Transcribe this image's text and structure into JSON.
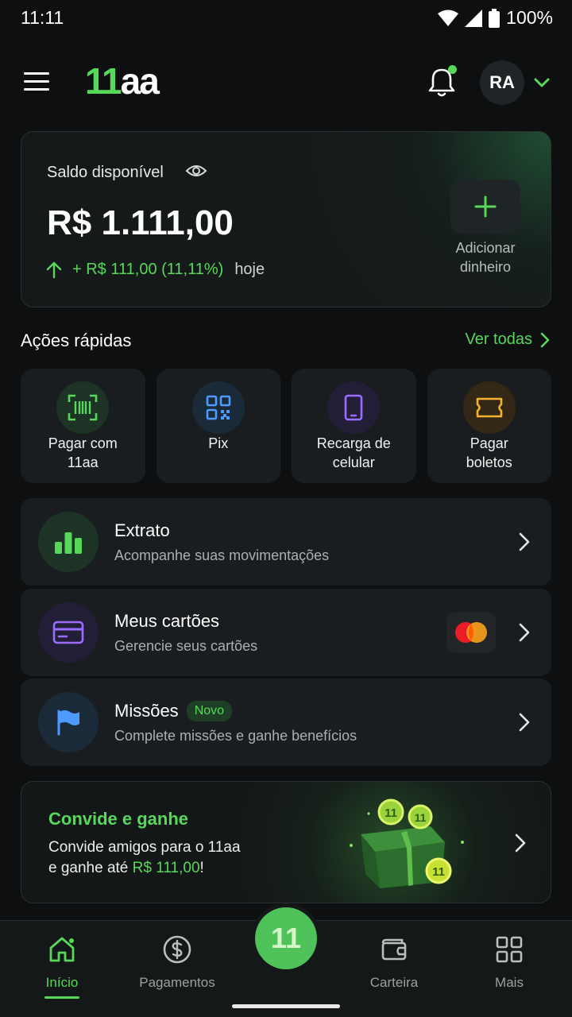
{
  "status_bar": {
    "time": "11:11",
    "battery": "100%"
  },
  "header": {
    "logo_part1": "11",
    "logo_part2": "aa",
    "avatar_initials": "RA"
  },
  "balance": {
    "label": "Saldo disponível",
    "amount": "R$ 1.111,00",
    "change": "+ R$ 111,00 (11,11%)",
    "change_period": "hoje",
    "add_money_line1": "Adicionar",
    "add_money_line2": "dinheiro"
  },
  "quick_actions": {
    "title": "Ações rápidas",
    "see_all": "Ver todas",
    "items": [
      {
        "line1": "Pagar com",
        "line2": "11aa",
        "icon": "barcode-scan-icon"
      },
      {
        "line1": "Pix",
        "line2": "",
        "icon": "qr-code-icon"
      },
      {
        "line1": "Recarga de",
        "line2": "celular",
        "icon": "phone-icon"
      },
      {
        "line1": "Pagar",
        "line2": "boletos",
        "icon": "ticket-icon"
      }
    ]
  },
  "rows": [
    {
      "title": "Extrato",
      "subtitle": "Acompanhe suas movimentações",
      "icon": "bar-chart-icon"
    },
    {
      "title": "Meus cartões",
      "subtitle": "Gerencie seus cartões",
      "icon": "credit-card-icon"
    },
    {
      "title": "Missões",
      "badge": "Novo",
      "subtitle": "Complete missões e ganhe benefícios",
      "icon": "flag-icon"
    }
  ],
  "promo": {
    "title": "Convide e ganhe",
    "text_line1": "Convide amigos para o 11aa",
    "text_line2_prefix": "e ganhe até ",
    "text_amount": "R$ 111,00",
    "text_suffix": "!",
    "coin_label": "11"
  },
  "bottom_nav": {
    "items": [
      "Início",
      "Pagamentos",
      "Carteira",
      "Mais"
    ],
    "center_label": "11",
    "active": "Início"
  },
  "colors": {
    "accent": "#57d85a",
    "background": "#0d0f10",
    "card": "#1a1d1f"
  }
}
